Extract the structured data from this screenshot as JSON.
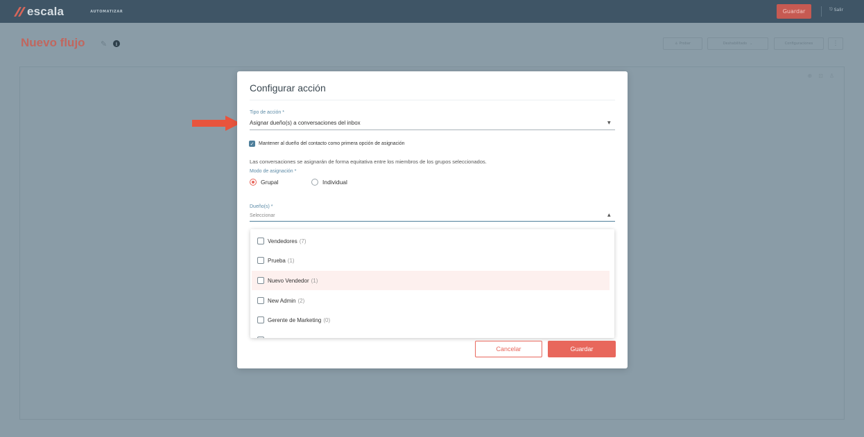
{
  "topbar": {
    "logo_text": "escala",
    "nav_item": "AUTOMATIZAR",
    "save_label": "Guardar",
    "exit_label": "Salir"
  },
  "page": {
    "title": "Nuevo flujo",
    "toolbar": {
      "test_label": "Probar",
      "status_label": "Deshabilitado",
      "config_label": "Configuraciones"
    }
  },
  "modal": {
    "title": "Configurar acción",
    "action_type": {
      "label": "Tipo de acción *",
      "value": "Asignar dueño(s) a conversaciones del inbox"
    },
    "keep_owner": {
      "checked": true,
      "label": "Mantener al dueño del contacto como primera opción de asignación"
    },
    "info_text": "Las conversaciones se asignarán de forma equitativa entre los miembros de los grupos seleccionados.",
    "assignment_mode": {
      "label": "Modo de asignación *",
      "options": [
        {
          "label": "Grupal",
          "selected": true
        },
        {
          "label": "Individual",
          "selected": false
        }
      ]
    },
    "owners": {
      "label": "Dueño(s) *",
      "placeholder": "Seleccionar",
      "options": [
        {
          "name": "Vendedores",
          "count": "(7)",
          "highlighted": false
        },
        {
          "name": "Prueba",
          "count": "(1)",
          "highlighted": false
        },
        {
          "name": "Nuevo Vendedor",
          "count": "(1)",
          "highlighted": true
        },
        {
          "name": "New Admin",
          "count": "(2)",
          "highlighted": false
        },
        {
          "name": "Gerente de Marketing",
          "count": "(0)",
          "highlighted": false
        }
      ]
    },
    "cancel_label": "Cancelar",
    "save_label": "Guardar"
  },
  "colors": {
    "accent": "#e8675c",
    "primary": "#4f7f9b",
    "overlay": "#8a9ca7",
    "topbar": "#3f5566"
  }
}
